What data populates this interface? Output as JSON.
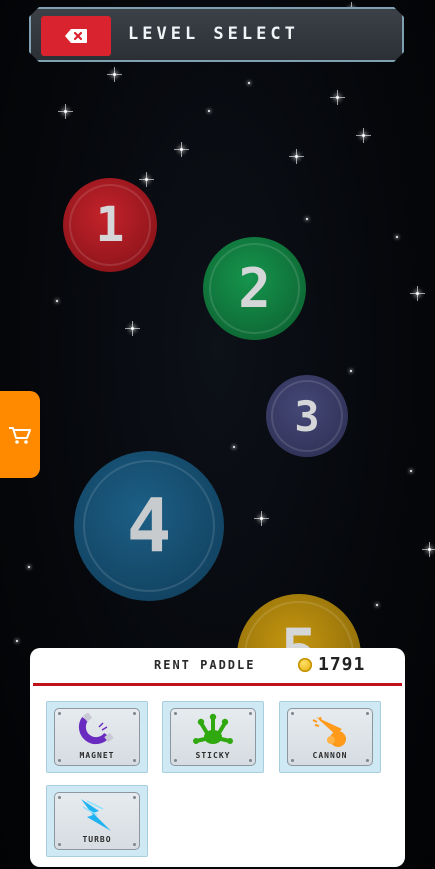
{
  "header": {
    "title": "LEVEL SELECT",
    "back_icon": "backspace-icon"
  },
  "levels": [
    {
      "number": "1",
      "color": "#b71c23"
    },
    {
      "number": "2",
      "color": "#138a46"
    },
    {
      "number": "3",
      "color": "#3b3d6a"
    },
    {
      "number": "4",
      "color": "#17527a"
    },
    {
      "number": "5",
      "color": "#b88b0c"
    }
  ],
  "shop": {
    "icon": "shopping-cart-icon",
    "color": "#ff8a00"
  },
  "rent_panel": {
    "title": "RENT PADDLE",
    "coins": "1791",
    "powerups": [
      {
        "label": "MAGNET",
        "icon": "magnet-icon",
        "color": "#6a2cc0"
      },
      {
        "label": "STICKY",
        "icon": "sticky-paw-icon",
        "color": "#2fa90f"
      },
      {
        "label": "CANNON",
        "icon": "cannon-icon",
        "color": "#ff9a1a"
      },
      {
        "label": "TURBO",
        "icon": "turbo-icon",
        "color": "#1fb3f2"
      }
    ]
  }
}
